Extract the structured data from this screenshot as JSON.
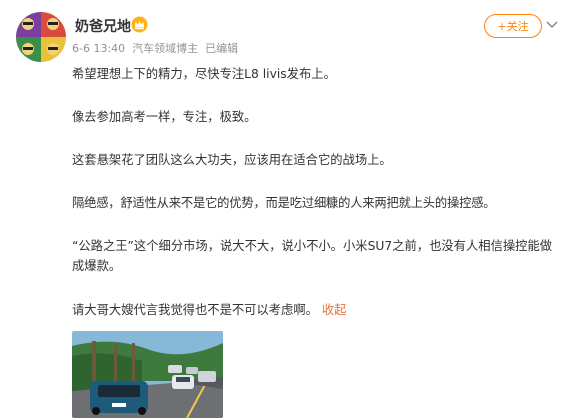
{
  "post": {
    "author": "奶爸兄地",
    "time": "6-6 13:40",
    "source": "汽车领域博主",
    "edited": "已编辑",
    "follow_label": "+关注",
    "paragraphs": [
      "希望理想上下的精力，尽快专注L8 livis发布上。",
      "像去参加高考一样，专注，极致。",
      "这套悬架花了团队这么大功夫，应该用在适合它的战场上。",
      "隔绝感，舒适性从来不是它的优势，而是吃过细糠的人来两把就上头的操控感。",
      "“公路之王”这个细分市场，说大不大，说小不小。小米SU7之前，也没有人相信操控能做成爆款。",
      "请大哥大嫂代言我觉得也不是不可以考虑啊。"
    ],
    "collapse_label": "收起"
  },
  "icons": {
    "crown": "crown-badge-icon",
    "more": "chevron-down-icon"
  },
  "colors": {
    "accent": "#ff8200",
    "collapse": "#eb7340",
    "meta": "#939393",
    "text": "#333333"
  }
}
